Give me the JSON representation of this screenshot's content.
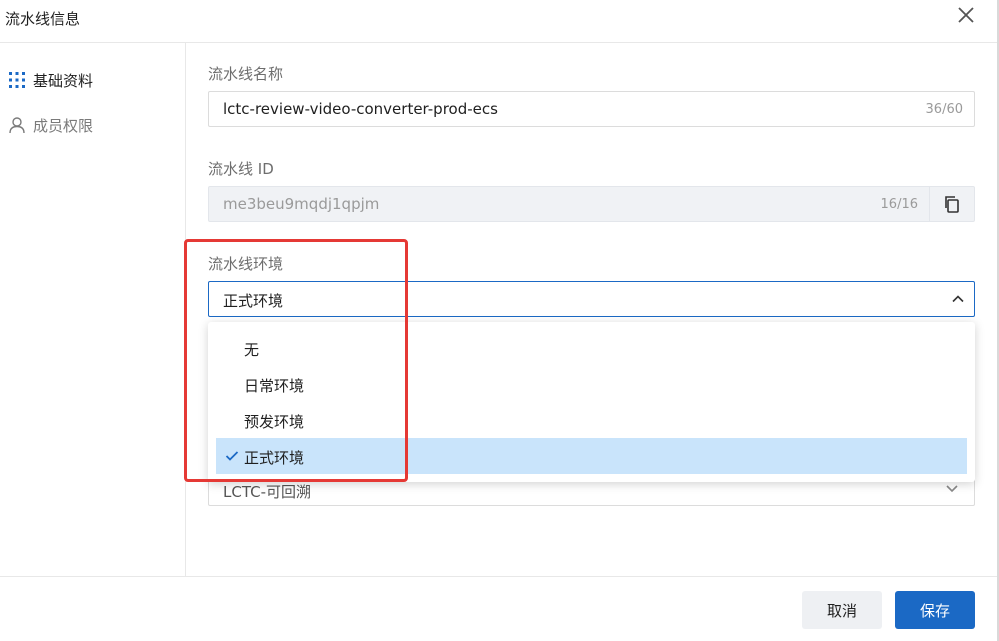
{
  "dialog": {
    "title": "流水线信息"
  },
  "sidebar": {
    "items": [
      {
        "label": "基础资料",
        "icon": "grid-icon",
        "active": true
      },
      {
        "label": "成员权限",
        "icon": "user-icon",
        "active": false
      }
    ]
  },
  "form": {
    "name": {
      "label": "流水线名称",
      "value": "lctc-review-video-converter-prod-ecs",
      "count": "36/60"
    },
    "id": {
      "label": "流水线 ID",
      "value": "me3beu9mqdj1qpjm",
      "count": "16/16"
    },
    "env": {
      "label": "流水线环境",
      "value": "正式环境",
      "options": [
        "无",
        "日常环境",
        "预发环境",
        "正式环境"
      ],
      "selected": "正式环境"
    },
    "next_select": {
      "value": "LCTC-可回溯"
    }
  },
  "footer": {
    "cancel_label": "取消",
    "save_label": "保存"
  },
  "colors": {
    "accent": "#1b69c5",
    "highlight": "#e53935",
    "selected_bg": "#c9e4fb"
  }
}
